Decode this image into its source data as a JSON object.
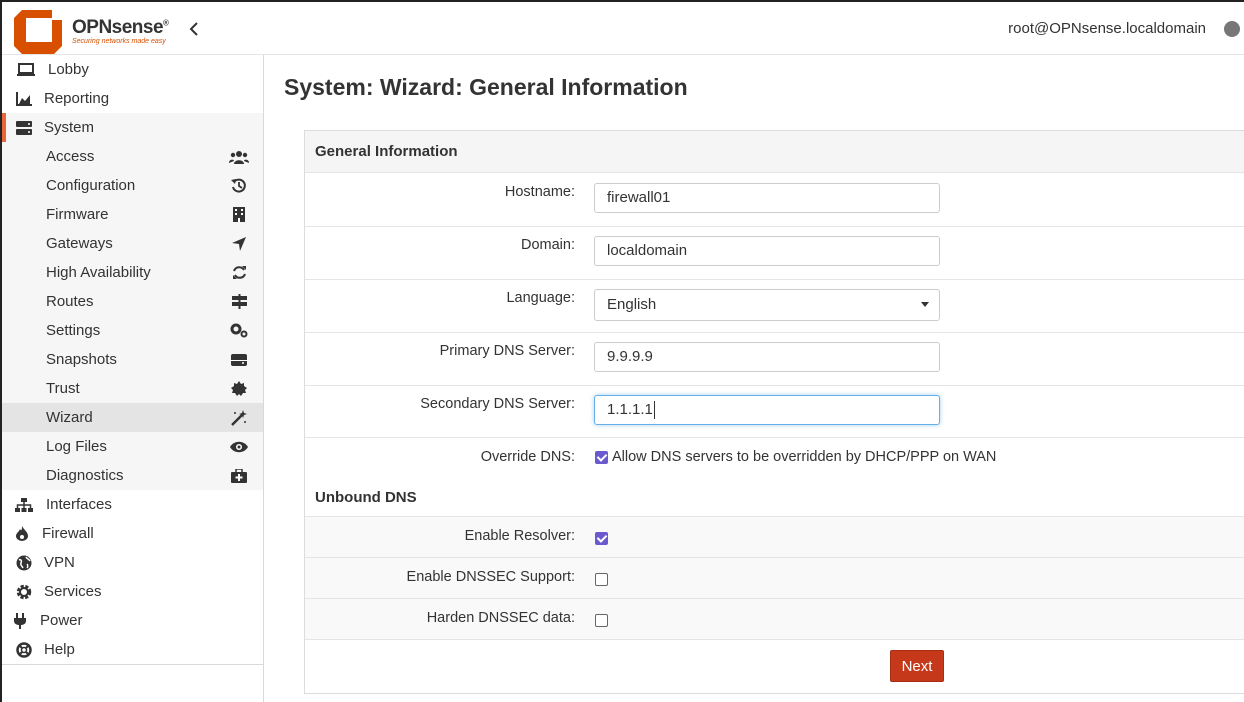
{
  "header": {
    "brand": "OPNsense",
    "brand_mark": "®",
    "tagline": "Securing networks made easy",
    "user": "root@OPNsense.localdomain"
  },
  "sidebar": {
    "top_items": [
      {
        "label": "Lobby",
        "icon": "laptop-icon"
      },
      {
        "label": "Reporting",
        "icon": "area-chart-icon"
      },
      {
        "label": "System",
        "icon": "server-icon"
      }
    ],
    "system_items": [
      {
        "label": "Access",
        "icon": "users-icon"
      },
      {
        "label": "Configuration",
        "icon": "history-icon"
      },
      {
        "label": "Firmware",
        "icon": "building-icon"
      },
      {
        "label": "Gateways",
        "icon": "location-arrow-icon"
      },
      {
        "label": "High Availability",
        "icon": "refresh-icon"
      },
      {
        "label": "Routes",
        "icon": "signs-icon"
      },
      {
        "label": "Settings",
        "icon": "cogs-icon"
      },
      {
        "label": "Snapshots",
        "icon": "hdd-icon"
      },
      {
        "label": "Trust",
        "icon": "certificate-icon"
      },
      {
        "label": "Wizard",
        "icon": "magic-wand-icon",
        "active": true
      },
      {
        "label": "Log Files",
        "icon": "eye-icon"
      },
      {
        "label": "Diagnostics",
        "icon": "medkit-icon"
      }
    ],
    "bottom_items": [
      {
        "label": "Interfaces",
        "icon": "sitemap-icon"
      },
      {
        "label": "Firewall",
        "icon": "fire-icon"
      },
      {
        "label": "VPN",
        "icon": "globe-icon"
      },
      {
        "label": "Services",
        "icon": "cog-icon"
      },
      {
        "label": "Power",
        "icon": "plug-icon"
      },
      {
        "label": "Help",
        "icon": "life-ring-icon"
      }
    ]
  },
  "main": {
    "title": "System: Wizard: General Information",
    "general_section": "General Information",
    "hostname_label": "Hostname:",
    "hostname_value": "firewall01",
    "domain_label": "Domain:",
    "domain_value": "localdomain",
    "language_label": "Language:",
    "language_value": "English",
    "dns1_label": "Primary DNS Server:",
    "dns1_value": "9.9.9.9",
    "dns2_label": "Secondary DNS Server:",
    "dns2_value": "1.1.1.1",
    "override_label": "Override DNS:",
    "override_text": "Allow DNS servers to be overridden by DHCP/PPP on WAN",
    "unbound_section": "Unbound DNS",
    "resolver_label": "Enable Resolver:",
    "dnssec_label": "Enable DNSSEC Support:",
    "harden_label": "Harden DNSSEC data:",
    "next_label": "Next"
  },
  "colors": {
    "brand_orange": "#d94f00",
    "stripe": "#e8663a",
    "next_button": "#c5391a",
    "checkbox": "#6a5acd"
  }
}
